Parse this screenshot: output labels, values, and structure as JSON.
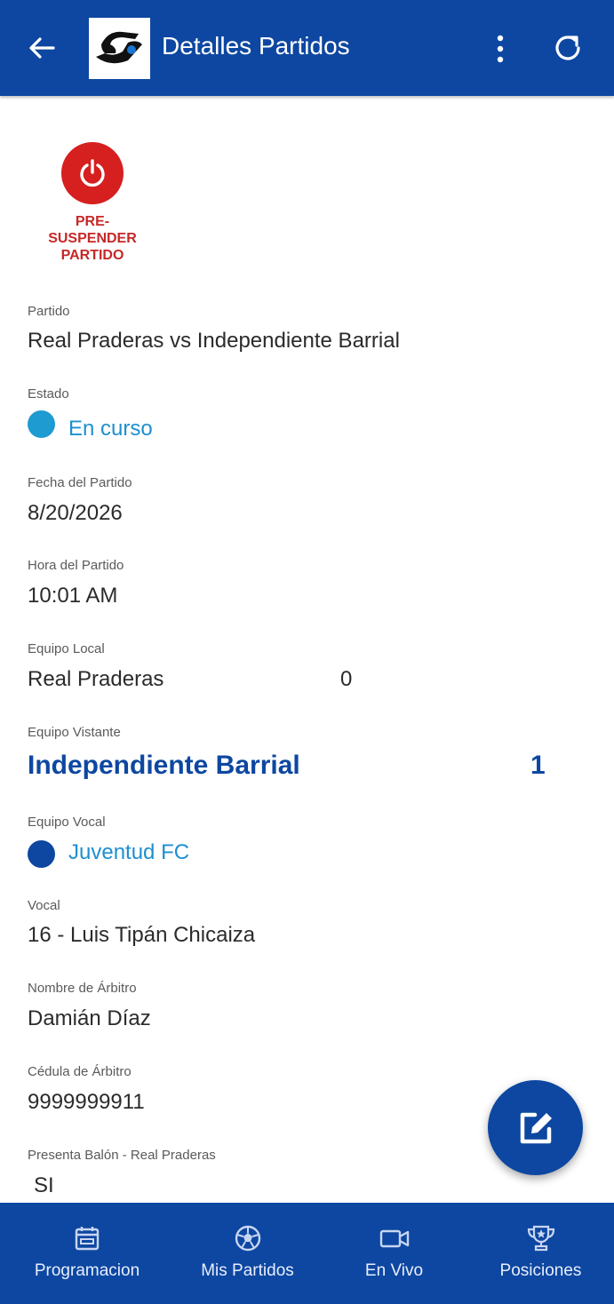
{
  "appbar": {
    "title": "Detalles Partidos",
    "logo_text": "SJ",
    "back_icon": "arrow-left-icon",
    "more_icon": "more-vertical-icon",
    "refresh_icon": "refresh-icon"
  },
  "suspend": {
    "label_line1": "PRE-",
    "label_line2": "SUSPENDER",
    "label_line3": "PARTIDO",
    "icon": "power-icon",
    "color": "#d61f1f"
  },
  "fields": {
    "partido": {
      "label": "Partido",
      "value": "Real Praderas vs Independiente Barrial"
    },
    "estado": {
      "label": "Estado",
      "value": "En curso",
      "dot_color": "#1e9bd0"
    },
    "fecha": {
      "label": "Fecha del Partido",
      "value": "8/20/2026"
    },
    "hora": {
      "label": "Hora del Partido",
      "value": "10:01 AM"
    },
    "local": {
      "label": "Equipo Local",
      "value": "Real Praderas",
      "score": "0"
    },
    "visitante": {
      "label": "Equipo Vistante",
      "value": "Independiente Barrial",
      "score": "1"
    },
    "vocal_equipo": {
      "label": "Equipo Vocal",
      "value": "Juventud FC",
      "dot_color": "#0d47a1"
    },
    "vocal": {
      "label": "Vocal",
      "value": "16 - Luis Tipán Chicaiza"
    },
    "arbitro": {
      "label": "Nombre de Árbitro",
      "value": "Damián Díaz"
    },
    "cedula": {
      "label": "Cédula de Árbitro",
      "value": "9999999911"
    },
    "balon": {
      "label": "Presenta Balón - Real Praderas",
      "value": "SI"
    }
  },
  "fab": {
    "icon": "edit-icon"
  },
  "bottomnav": {
    "items": [
      {
        "label": "Programacion",
        "icon": "calendar-icon"
      },
      {
        "label": "Mis Partidos",
        "icon": "soccer-ball-icon"
      },
      {
        "label": "En Vivo",
        "icon": "video-camera-icon"
      },
      {
        "label": "Posiciones",
        "icon": "trophy-icon"
      }
    ]
  },
  "colors": {
    "primary": "#0d47a1",
    "accent_link": "#1e8fd0",
    "danger": "#c62828"
  }
}
